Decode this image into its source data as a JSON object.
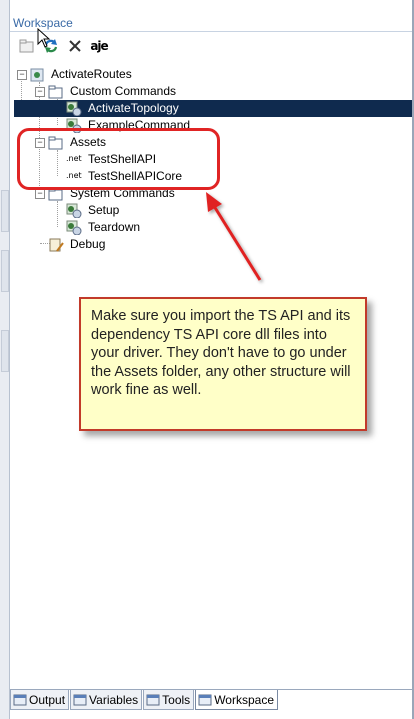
{
  "panel": {
    "title": "Workspace"
  },
  "toolbar": {
    "text_button": "aje"
  },
  "tree": {
    "root": "ActivateRoutes",
    "custom_commands": "Custom Commands",
    "activate_topology": "ActivateTopology",
    "example_command": "ExampleCommand",
    "assets": "Assets",
    "testshell_api": "TestShellAPI",
    "testshell_api_core": "TestShellAPICore",
    "net_badge": ".net",
    "system_commands": "System Commands",
    "setup": "Setup",
    "teardown": "Teardown",
    "debug": "Debug",
    "expander_minus": "−"
  },
  "note": {
    "text": "Make sure you import the TS API and its dependency TS API core dll files into your driver.  They don't have to go under the Assets folder, any other structure will work fine as well."
  },
  "tabs": [
    {
      "label": "Output"
    },
    {
      "label": "Variables"
    },
    {
      "label": "Tools"
    },
    {
      "label": "Workspace"
    }
  ],
  "colors": {
    "selection": "#0f2a4e",
    "annotation": "#e02424",
    "note_fill": "#ffffc8",
    "title_blue": "#3a6aa6"
  }
}
